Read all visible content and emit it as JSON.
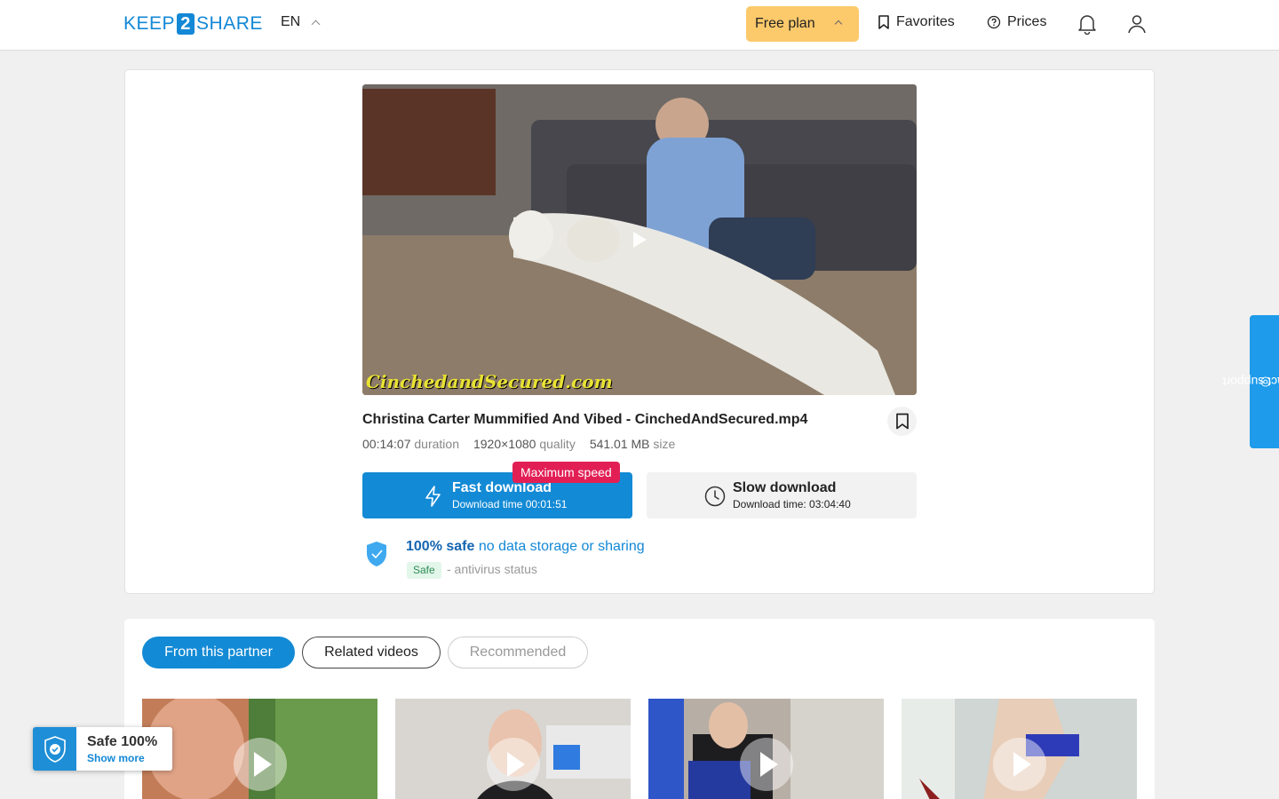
{
  "header": {
    "logo_left": "KEEP",
    "logo_mid": "2",
    "logo_right": "SHARE",
    "language": "EN",
    "plan_label": "Free plan",
    "favorites_label": "Favorites",
    "prices_label": "Prices"
  },
  "file": {
    "watermark": "CinchedandSecured.com",
    "title": "Christina Carter Mummified And Vibed - CinchedAndSecured.mp4",
    "duration_value": "00:14:07",
    "duration_label": "duration",
    "quality_value": "1920×1080",
    "quality_label": "quality",
    "size_value": "541.01 MB",
    "size_label": "size"
  },
  "download": {
    "max_speed_badge": "Maximum speed",
    "fast_label": "Fast download",
    "fast_time": "Download time 00:01:51",
    "slow_label": "Slow download",
    "slow_time": "Download time: 03:04:40"
  },
  "safety": {
    "headline_strong": "100% safe",
    "headline_rest": "no data storage or sharing",
    "badge": "Safe",
    "status_text": "- antivirus status"
  },
  "tabs": [
    {
      "label": "From this partner",
      "state": "active"
    },
    {
      "label": "Related videos",
      "state": "default"
    },
    {
      "label": "Recommended",
      "state": "disabled"
    }
  ],
  "support": {
    "label": "contact support"
  },
  "safe_widget": {
    "title": "Safe 100%",
    "link": "Show more"
  },
  "colors": {
    "brand": "#138ad5",
    "plan": "#fcc96b",
    "badge": "#e21f55"
  }
}
